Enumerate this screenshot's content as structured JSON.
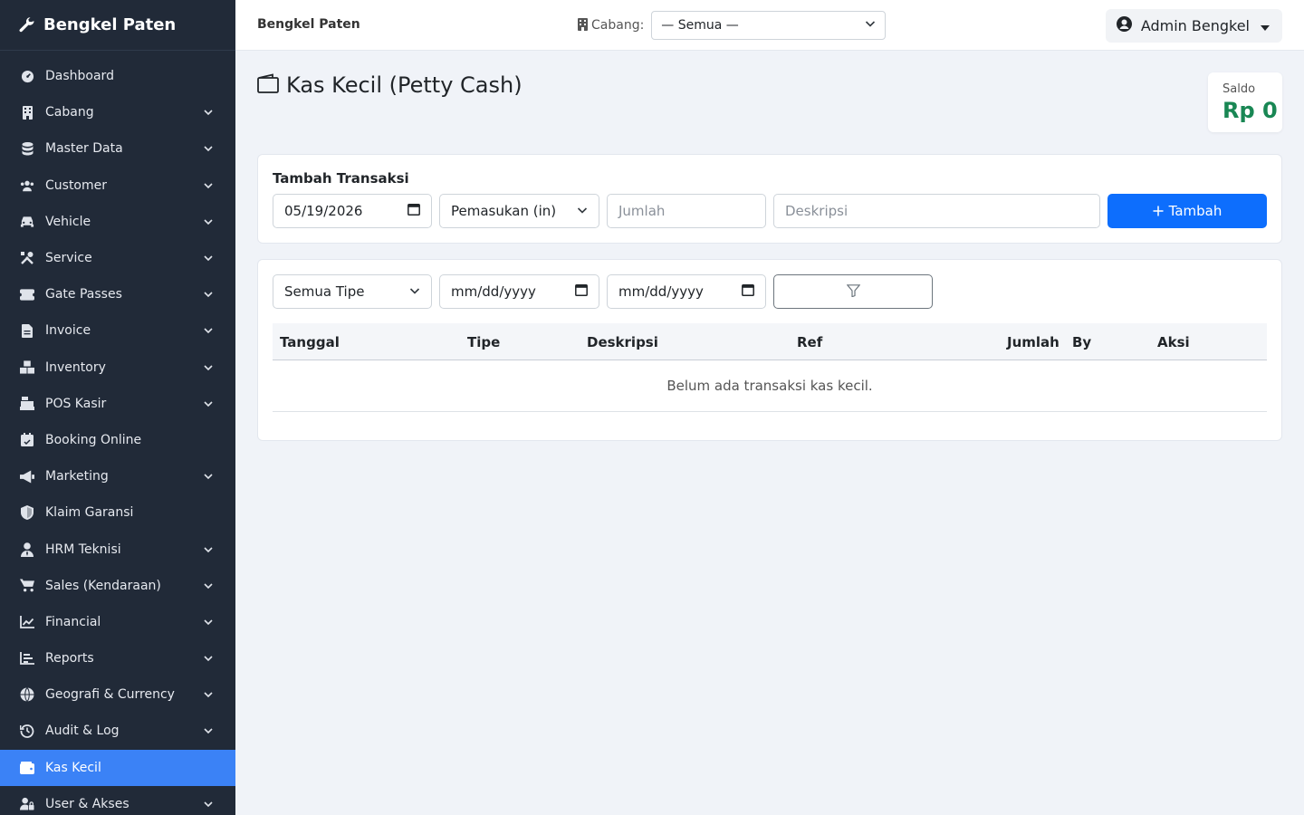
{
  "brand": {
    "name": "Bengkel Paten",
    "icon": "wrench-icon"
  },
  "sidebar": {
    "items": [
      {
        "label": "Dashboard",
        "icon": "gauge-icon",
        "expandable": false
      },
      {
        "label": "Cabang",
        "icon": "building-icon",
        "expandable": true
      },
      {
        "label": "Master Data",
        "icon": "database-icon",
        "expandable": true
      },
      {
        "label": "Customer",
        "icon": "users-icon",
        "expandable": true
      },
      {
        "label": "Vehicle",
        "icon": "car-icon",
        "expandable": true
      },
      {
        "label": "Service",
        "icon": "tools-icon",
        "expandable": true
      },
      {
        "label": "Gate Passes",
        "icon": "ticket-icon",
        "expandable": true
      },
      {
        "label": "Invoice",
        "icon": "invoice-icon",
        "expandable": true
      },
      {
        "label": "Inventory",
        "icon": "boxes-icon",
        "expandable": true
      },
      {
        "label": "POS Kasir",
        "icon": "cash-register-icon",
        "expandable": true
      },
      {
        "label": "Booking Online",
        "icon": "calendar-check-icon",
        "expandable": false
      },
      {
        "label": "Marketing",
        "icon": "bullhorn-icon",
        "expandable": true
      },
      {
        "label": "Klaim Garansi",
        "icon": "shield-icon",
        "expandable": false
      },
      {
        "label": "HRM Teknisi",
        "icon": "user-tie-icon",
        "expandable": true
      },
      {
        "label": "Sales (Kendaraan)",
        "icon": "cart-icon",
        "expandable": true
      },
      {
        "label": "Financial",
        "icon": "chart-line-icon",
        "expandable": true
      },
      {
        "label": "Reports",
        "icon": "chart-bar-icon",
        "expandable": true
      },
      {
        "label": "Geografi & Currency",
        "icon": "globe-icon",
        "expandable": true
      },
      {
        "label": "Audit & Log",
        "icon": "history-icon",
        "expandable": true
      },
      {
        "label": "Kas Kecil",
        "icon": "wallet-icon",
        "expandable": false,
        "active": true
      },
      {
        "label": "User & Akses",
        "icon": "user-lock-icon",
        "expandable": true
      }
    ]
  },
  "topbar": {
    "title": "Bengkel Paten",
    "branch_label": "Cabang:",
    "branch_value": "— Semua —",
    "user_name": "Admin Bengkel"
  },
  "page": {
    "title": "Kas Kecil (Petty Cash)",
    "saldo_label": "Saldo",
    "saldo_value": "Rp 0"
  },
  "add_form": {
    "title": "Tambah Transaksi",
    "date_value": "05/19/2026",
    "type_value": "Pemasukan (in)",
    "amount_placeholder": "Jumlah",
    "desc_placeholder": "Deskripsi",
    "submit_label": "Tambah"
  },
  "filter": {
    "type_value": "Semua Tipe",
    "date_from_placeholder": "mm/dd/yyyy",
    "date_to_placeholder": "mm/dd/yyyy"
  },
  "table": {
    "columns": [
      "Tanggal",
      "Tipe",
      "Deskripsi",
      "Ref",
      "Jumlah",
      "By",
      "Aksi"
    ],
    "empty_text": "Belum ada transaksi kas kecil."
  },
  "colors": {
    "sidebar_bg": "#212a38",
    "active_item": "#3b82f6",
    "primary_button": "#0d6efd",
    "saldo_green": "#198754"
  }
}
